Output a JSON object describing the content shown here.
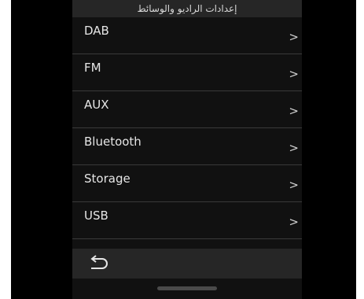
{
  "header": {
    "title": "إعدادات الراديو والوسائط"
  },
  "menu": {
    "items": [
      {
        "label": "DAB",
        "chevron": ">"
      },
      {
        "label": "FM",
        "chevron": ">"
      },
      {
        "label": "AUX",
        "chevron": ">"
      },
      {
        "label": "Bluetooth",
        "chevron": ">"
      },
      {
        "label": "Storage",
        "chevron": ">"
      },
      {
        "label": "USB",
        "chevron": ">"
      }
    ]
  },
  "footer": {
    "back_icon": "back-arrow-icon"
  },
  "colors": {
    "background": "#000000",
    "panel": "#111111",
    "bar": "#262626",
    "text": "#e6e6e6",
    "divider": "#3a3a3a"
  }
}
